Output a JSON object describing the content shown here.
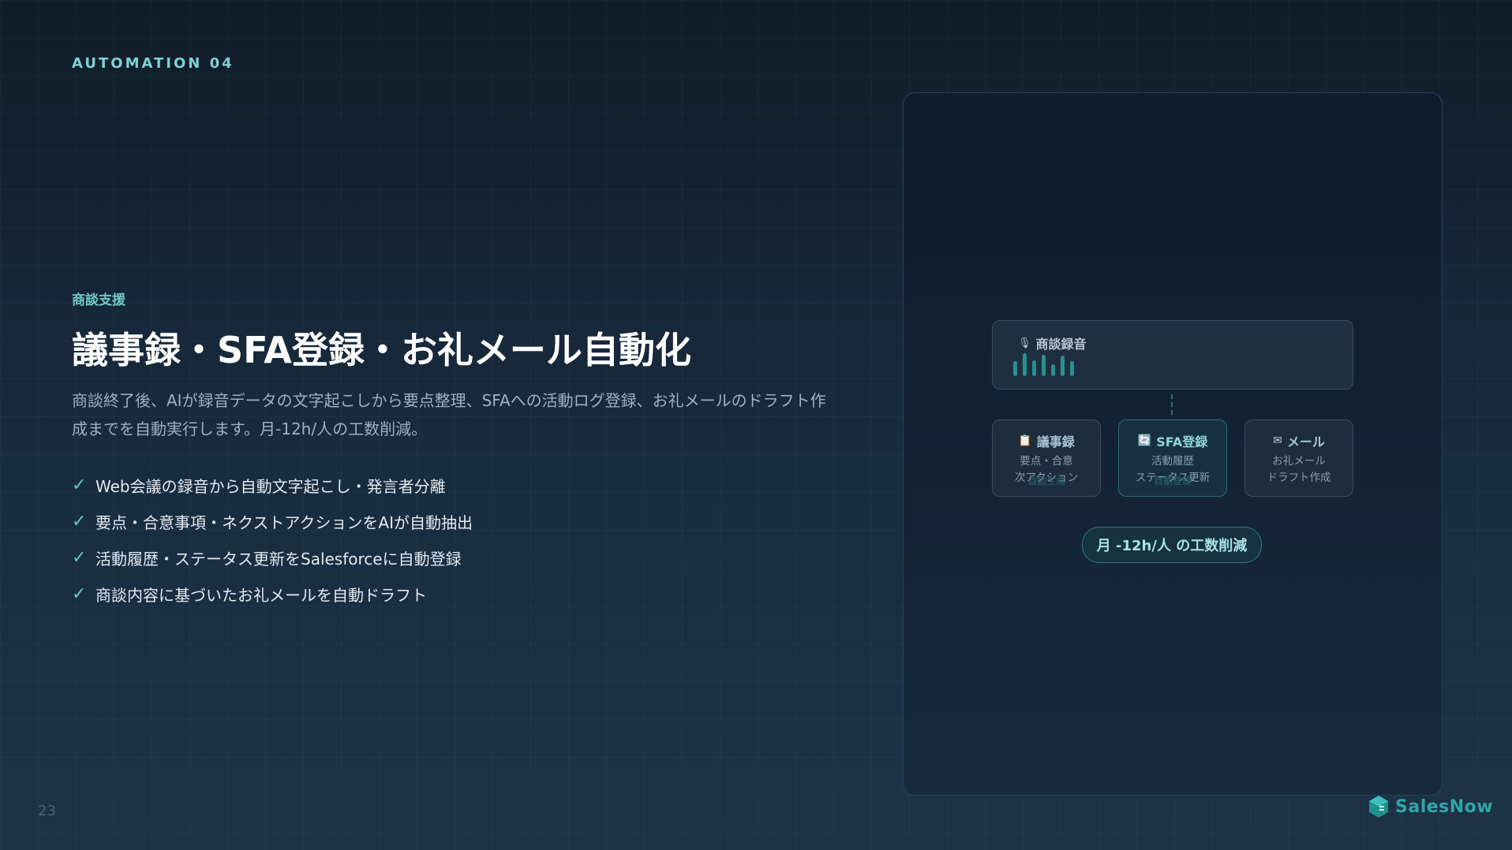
{
  "eyebrow": "AUTOMATION 04",
  "category": "商談支援",
  "title": "議事録・SFA登録・お礼メール自動化",
  "description": "商談終了後、AIが録音データの文字起こしから要点整理、SFAへの活動ログ登録、お礼メールのドラフト作成までを自動実行します。月-12h/人の工数削減。",
  "checklist": [
    "Web会議の録音から自動文字起こし・発言者分離",
    "要点・合意事項・ネクストアクションをAIが自動抽出",
    "活動履歴・ステータス更新をSalesforceに自動登録",
    "商談内容に基づいたお礼メールを自動ドラフト"
  ],
  "check_icon": "✓",
  "page_number": "23",
  "logo_text": "SalesNow",
  "diagram": {
    "recording": {
      "icon": "microphone-icon",
      "label": "商談録音",
      "waveform_levels": [
        0.55,
        0.85,
        0.6,
        0.8,
        0.45,
        0.75,
        0.55
      ]
    },
    "cards": [
      {
        "icon": "clipboard-icon",
        "icon_glyph": "📋",
        "title": "議事録",
        "line1": "要点・合意",
        "line2": "次アクション",
        "note": "自動生成",
        "active": false
      },
      {
        "icon": "sync-icon",
        "icon_glyph": "🔄",
        "title": "SFA登録",
        "line1": "活動履歴",
        "line2": "ステータス更新",
        "note": "自動登録",
        "active": true
      },
      {
        "icon": "mail-icon",
        "icon_glyph": "✉",
        "title": "メール",
        "line1": "お礼メール",
        "line2": "ドラフト作成",
        "note": "",
        "active": false
      }
    ],
    "badge": "月 -12h/人 の工数削減"
  },
  "colors": {
    "accent": "#5fc7c6",
    "logo": "#2fa7a7",
    "background": "#182c3f"
  }
}
